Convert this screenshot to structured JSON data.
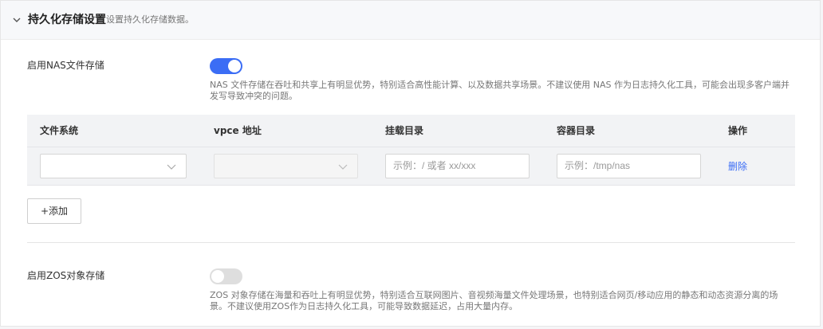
{
  "header": {
    "title": "持久化存储设置",
    "subtitle": "设置持久化存储数据。"
  },
  "nas": {
    "label": "启用NAS文件存储",
    "enabled": true,
    "description": "NAS 文件存储在吞吐和共享上有明显优势，特别适合高性能计算、以及数据共享场景。不建议使用 NAS 作为日志持久化工具，可能会出现多客户端并发写导致冲突的问题。"
  },
  "table": {
    "columns": [
      "文件系统",
      "vpce 地址",
      "挂载目录",
      "容器目录",
      "操作"
    ],
    "row": {
      "filesystem_value": "",
      "vpce_value": "",
      "mount_placeholder": "示例：/ 或者 xx/xxx",
      "container_placeholder": "示例：/tmp/nas",
      "delete_label": "删除"
    }
  },
  "add_button": "+添加",
  "zos": {
    "label": "启用ZOS对象存储",
    "enabled": false,
    "description": "ZOS 对象存储在海量和吞吐上有明显优势，特别适合互联网图片、音视频海量文件处理场景，也特别适合网页/移动应用的静态和动态资源分离的场景。不建议使用ZOS作为日志持久化工具，可能导致数据延迟，占用大量内存。"
  },
  "colors": {
    "accent": "#3b6df5",
    "toggle_off": "#dedede"
  },
  "icons": {
    "collapse": "chevron-down-icon",
    "select_arrow": "chevron-down-icon"
  }
}
